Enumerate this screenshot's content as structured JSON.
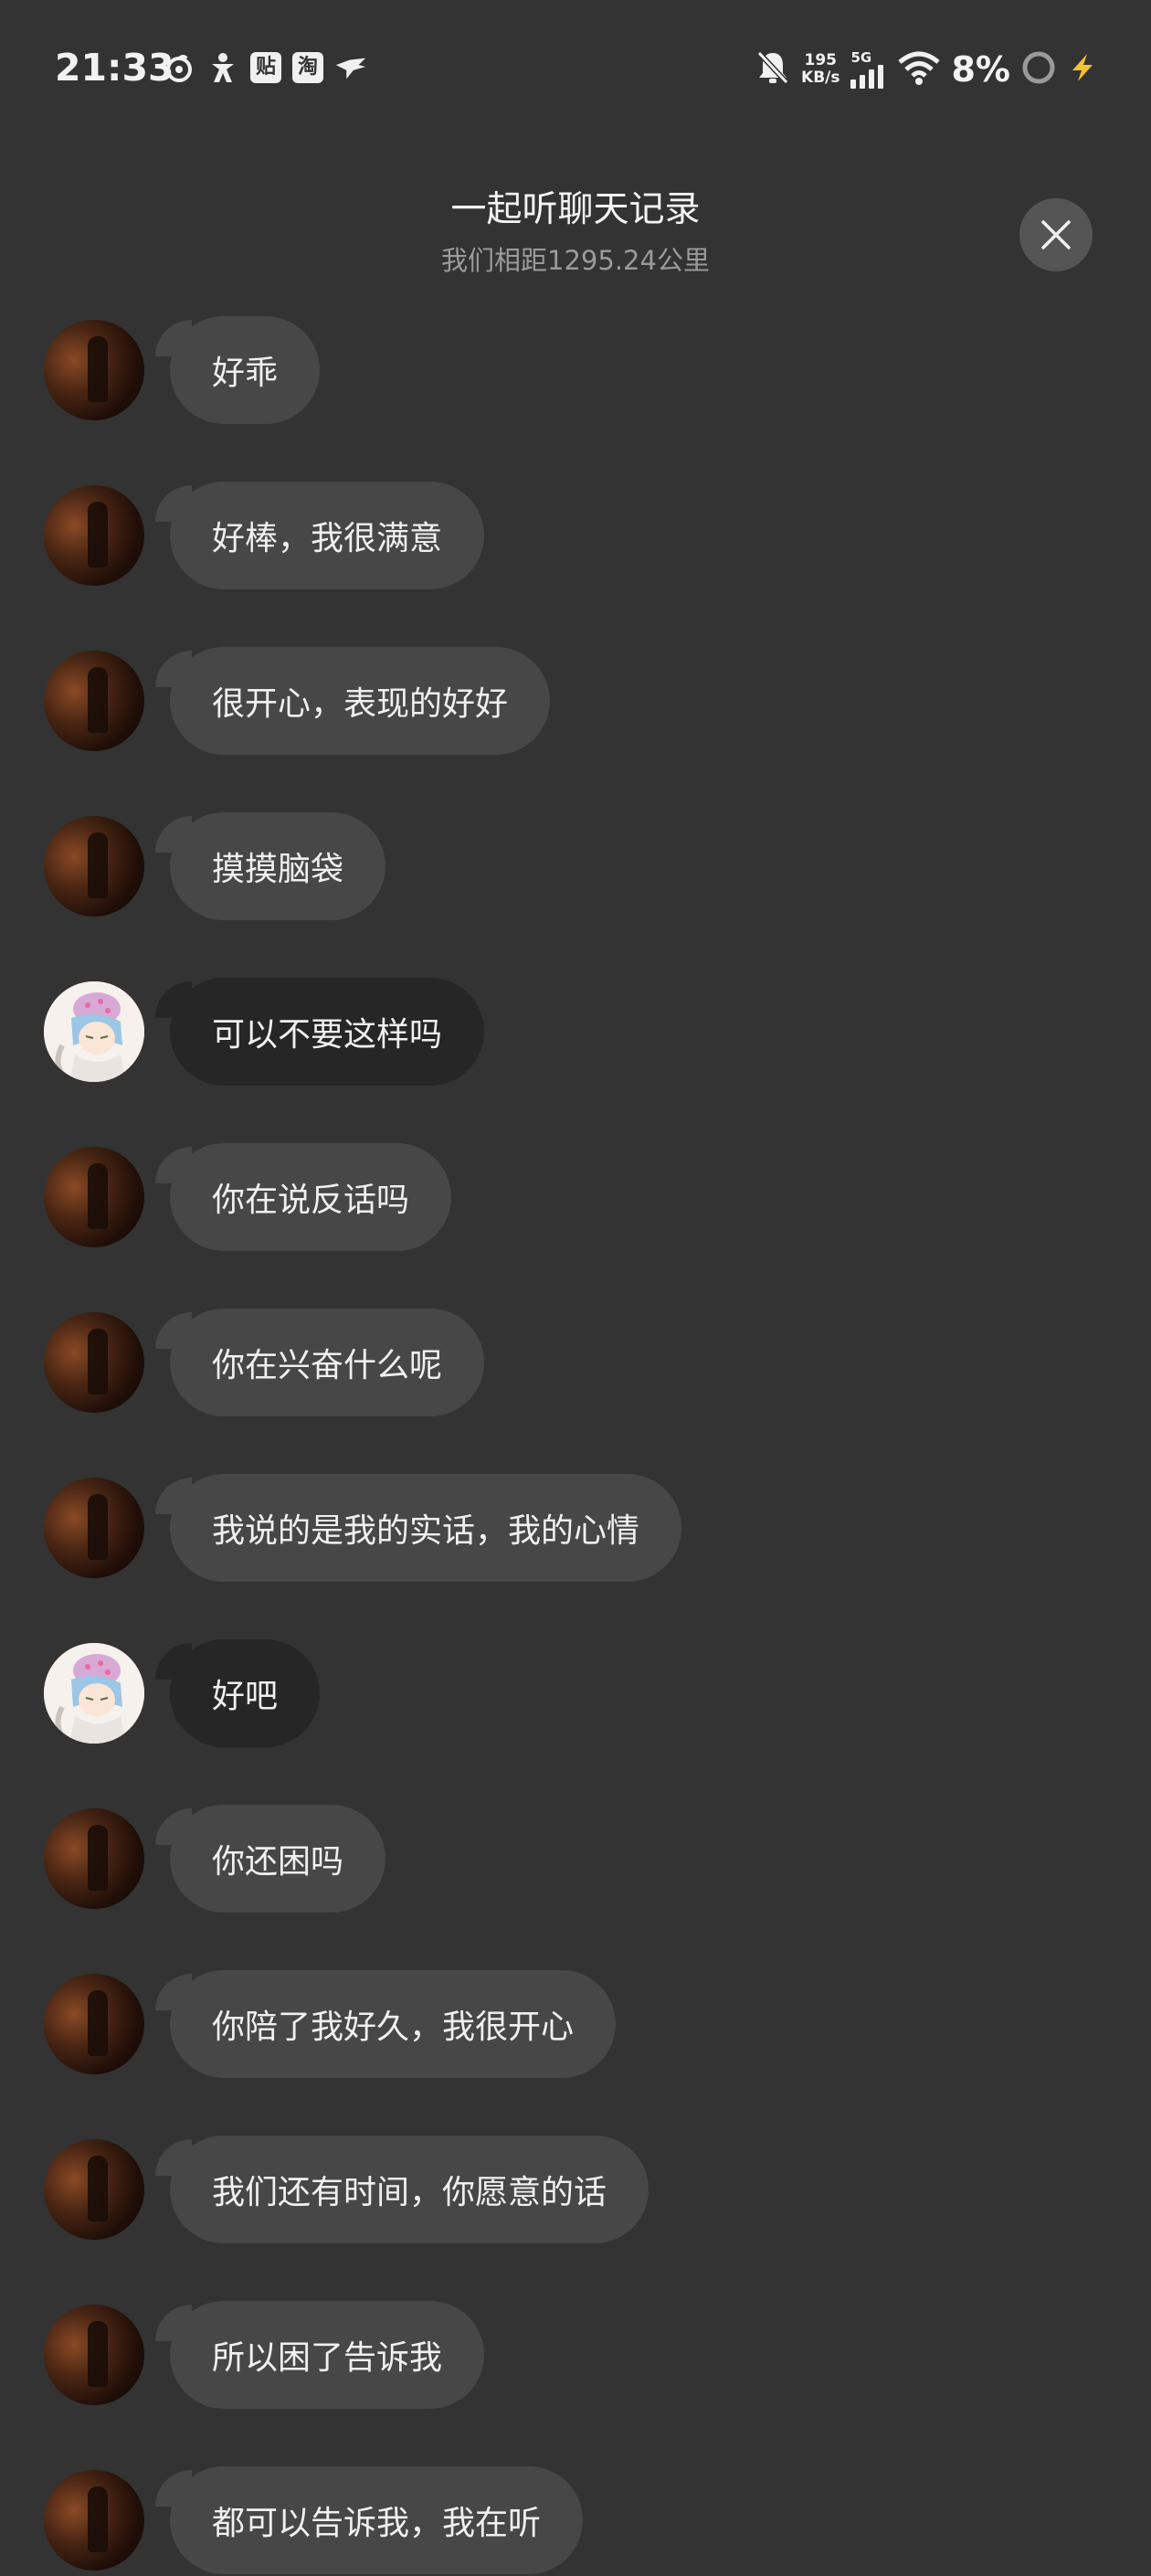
{
  "status_bar": {
    "time": "21:33",
    "app_badge_1": "贴",
    "app_badge_2": "淘",
    "net_speed_value": "195",
    "net_speed_unit": "KB/s",
    "network_type": "5G",
    "battery_percent": "8%",
    "icons": [
      "netease-music-icon",
      "person-app-icon",
      "tieba-icon",
      "taobao-icon",
      "bird-icon",
      "mute-bell-icon",
      "signal-icon",
      "wifi-icon",
      "battery-ring-icon",
      "charging-bolt-icon"
    ]
  },
  "header": {
    "title": "一起听聊天记录",
    "distance": "我们相距1295.24公里",
    "close_icon": "close-icon"
  },
  "colors": {
    "background": "#333333",
    "bubble_partner": "#474747",
    "bubble_self": "#262626"
  },
  "messages": [
    {
      "sender": "partner",
      "text": "好乖"
    },
    {
      "sender": "partner",
      "text": "好棒，我很满意"
    },
    {
      "sender": "partner",
      "text": "很开心，表现的好好"
    },
    {
      "sender": "partner",
      "text": "摸摸脑袋"
    },
    {
      "sender": "self",
      "text": "可以不要这样吗"
    },
    {
      "sender": "partner",
      "text": "你在说反话吗"
    },
    {
      "sender": "partner",
      "text": "你在兴奋什么呢"
    },
    {
      "sender": "partner",
      "text": "我说的是我的实话，我的心情"
    },
    {
      "sender": "self",
      "text": "好吧"
    },
    {
      "sender": "partner",
      "text": "你还困吗"
    },
    {
      "sender": "partner",
      "text": "你陪了我好久，我很开心"
    },
    {
      "sender": "partner",
      "text": "我们还有时间，你愿意的话"
    },
    {
      "sender": "partner",
      "text": "所以困了告诉我"
    },
    {
      "sender": "partner",
      "text": "都可以告诉我，我在听"
    }
  ]
}
